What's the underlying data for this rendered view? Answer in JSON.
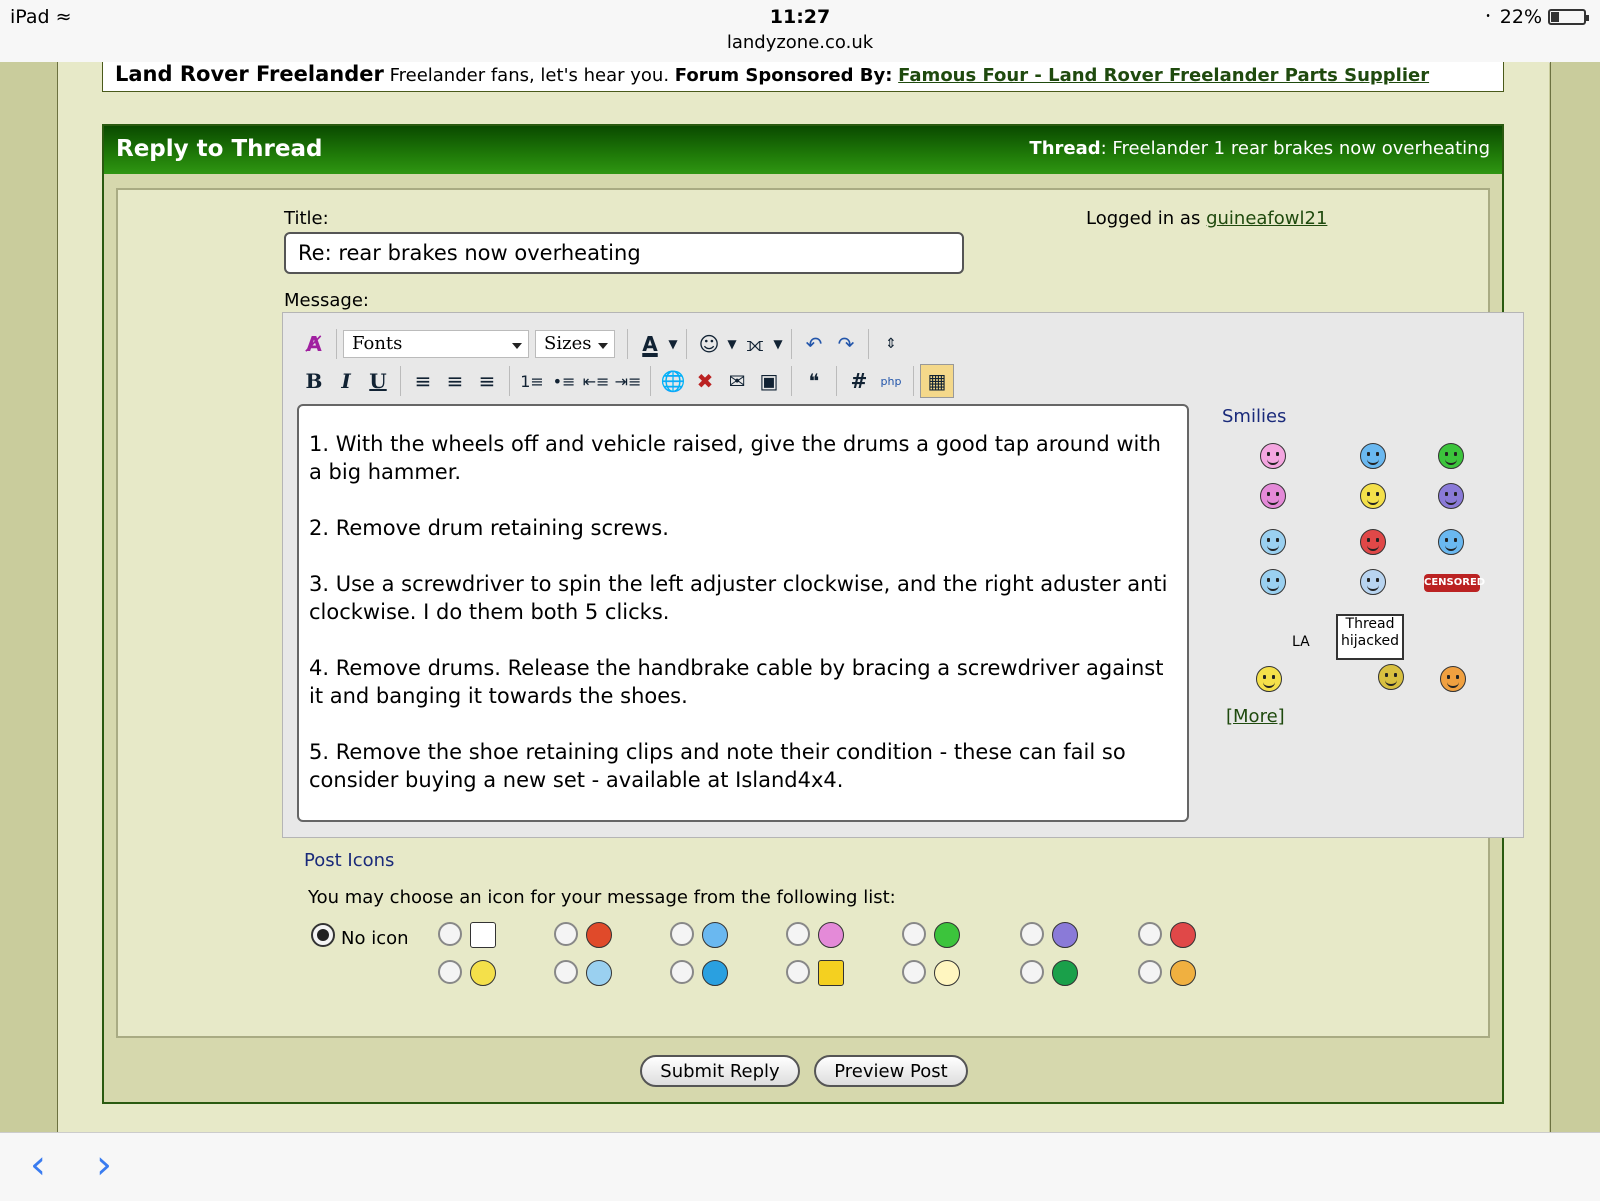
{
  "status_bar": {
    "device": "iPad",
    "time": "11:27",
    "url": "landyzone.co.uk",
    "battery": "22%"
  },
  "forum": {
    "name": "Land Rover Freelander",
    "tagline": "Freelander fans, let's hear you.",
    "sponsor_label": "Forum Sponsored By:",
    "sponsor_link": "Famous Four - Land Rover Freelander Parts Supplier"
  },
  "reply": {
    "heading": "Reply to Thread",
    "thread_label": "Thread",
    "thread_title": ": Freelander 1 rear brakes now overheating"
  },
  "form": {
    "title_label": "Title:",
    "title_value": "Re: rear brakes now overheating",
    "logged_in_label": "Logged in as",
    "username": "guineafowl21",
    "message_label": "Message:"
  },
  "toolbar": {
    "fonts": "Fonts",
    "sizes": "Sizes"
  },
  "message": {
    "p1": "1. With the wheels off and vehicle raised, give the drums a good tap around with a big hammer.",
    "p2": "2. Remove drum retaining screws.",
    "p3": "3. Use a screwdriver to spin the left adjuster clockwise, and the right aduster anti clockwise. I do them both 5 clicks.",
    "p4": "4. Remove drums. Release the handbrake cable by bracing a screwdriver against it and banging it towards the shoes.",
    "p5": "5. Remove the shoe retaining clips and note their condition - these can fail so consider buying a new set - available at Island4x4."
  },
  "smilies": {
    "title": "Smilies",
    "more": "[More]",
    "hijack_sign": "Thread hijacked",
    "la": "LA",
    "censored": "CENSORED"
  },
  "post_icons": {
    "title": "Post Icons",
    "description": "You may choose an icon for your message from the following list:",
    "no_icon": "No icon"
  },
  "buttons": {
    "submit": "Submit Reply",
    "preview": "Preview Post"
  },
  "colors": {
    "header_green": "#1f7a08",
    "link_green": "#1f4a0e",
    "page_bg": "#e7e9c8"
  }
}
